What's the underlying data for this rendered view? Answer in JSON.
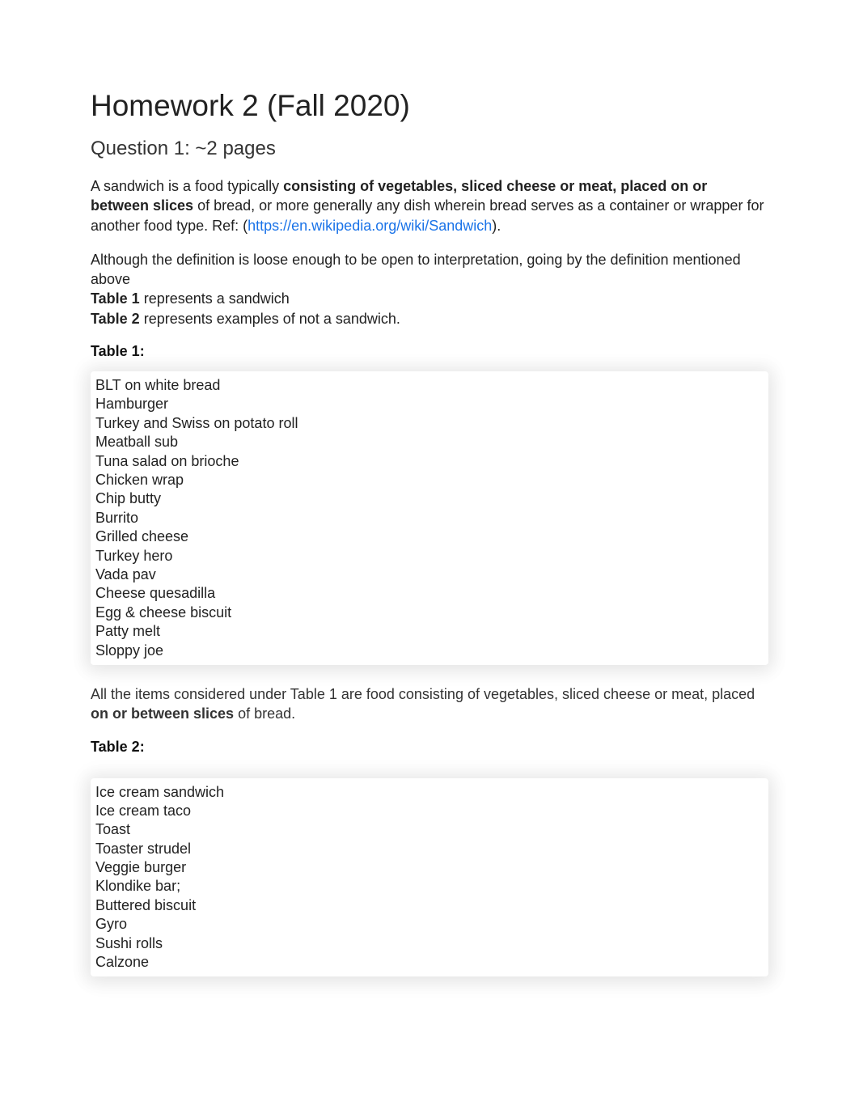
{
  "title": "Homework 2 (Fall 2020)",
  "subtitle": "Question 1: ~2 pages",
  "intro": {
    "lead": "A sandwich is a food typically ",
    "bold": "consisting of vegetables, sliced cheese or meat, placed on or between slices",
    "tail1": " of bread, or more generally any dish wherein bread serves as a container or wrapper for another food type. Ref: (",
    "link_text": "https://en.wikipedia.org/wiki/Sandwich",
    "link_href": "https://en.wikipedia.org/wiki/Sandwich",
    "tail2": ")."
  },
  "para2": {
    "line1": "Although the definition is loose enough to be open to interpretation, going by the definition mentioned above",
    "t1_label": "Table 1",
    "t1_text": " represents a sandwich",
    "t2_label": "Table 2",
    "t2_text": " represents examples of not a sandwich."
  },
  "table1": {
    "label": "Table 1:",
    "items": [
      "BLT on white bread",
      "Hamburger",
      "Turkey and Swiss on potato roll",
      "Meatball sub",
      "Tuna salad on brioche",
      "Chicken wrap",
      "Chip butty",
      "Burrito",
      "Grilled cheese",
      "Turkey hero",
      "Vada pav",
      "Cheese quesadilla",
      "Egg & cheese biscuit",
      "Patty melt",
      "Sloppy joe"
    ]
  },
  "after_table1": {
    "lead": "All the items considered under Table 1 are",
    "mid": " food consisting of vegetables, sliced cheese or meat, placed ",
    "bold": "on or between slices",
    "tail": " of bread."
  },
  "table2": {
    "label": "Table 2:",
    "items": [
      "Ice cream sandwich",
      "Ice cream taco",
      "Toast",
      "Toaster strudel",
      "Veggie burger",
      "Klondike bar;",
      "Buttered biscuit",
      "Gyro",
      "Sushi rolls",
      "Calzone"
    ]
  }
}
